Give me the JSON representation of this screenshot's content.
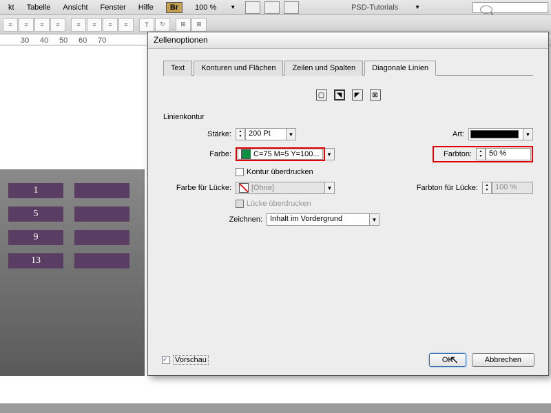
{
  "menu": {
    "items": [
      "kt",
      "Tabelle",
      "Ansicht",
      "Fenster",
      "Hilfe"
    ],
    "badge": "Br",
    "zoom": "100 %",
    "psd": "PSD-Tutorials"
  },
  "ruler": [
    "30",
    "40",
    "50",
    "60",
    "70"
  ],
  "doc": {
    "cells": [
      "1",
      "5",
      "9",
      "13"
    ]
  },
  "dialog": {
    "title": "Zellenoptionen",
    "tabs": [
      "Text",
      "Konturen und Flächen",
      "Zeilen und Spalten",
      "Diagonale Linien"
    ],
    "group": "Linienkontur",
    "labels": {
      "staerke": "Stärke:",
      "farbe": "Farbe:",
      "konturUeber": "Kontur überdrucken",
      "farbeLuecke": "Farbe für Lücke:",
      "lueckeUeber": "Lücke überdrucken",
      "zeichnen": "Zeichnen:",
      "art": "Art:",
      "farbton": "Farbton:",
      "farbtonLuecke": "Farbton für Lücke:"
    },
    "values": {
      "staerke": "200 Pt",
      "farbe": "C=75 M=5 Y=100...",
      "farbeLuecke": "[Ohne]",
      "zeichnen": "Inhalt im Vordergrund",
      "farbton": "50 %",
      "farbtonLuecke": "100 %"
    },
    "footer": {
      "vorschau": "Vorschau",
      "ok": "OK",
      "abbrechen": "Abbrechen"
    }
  }
}
